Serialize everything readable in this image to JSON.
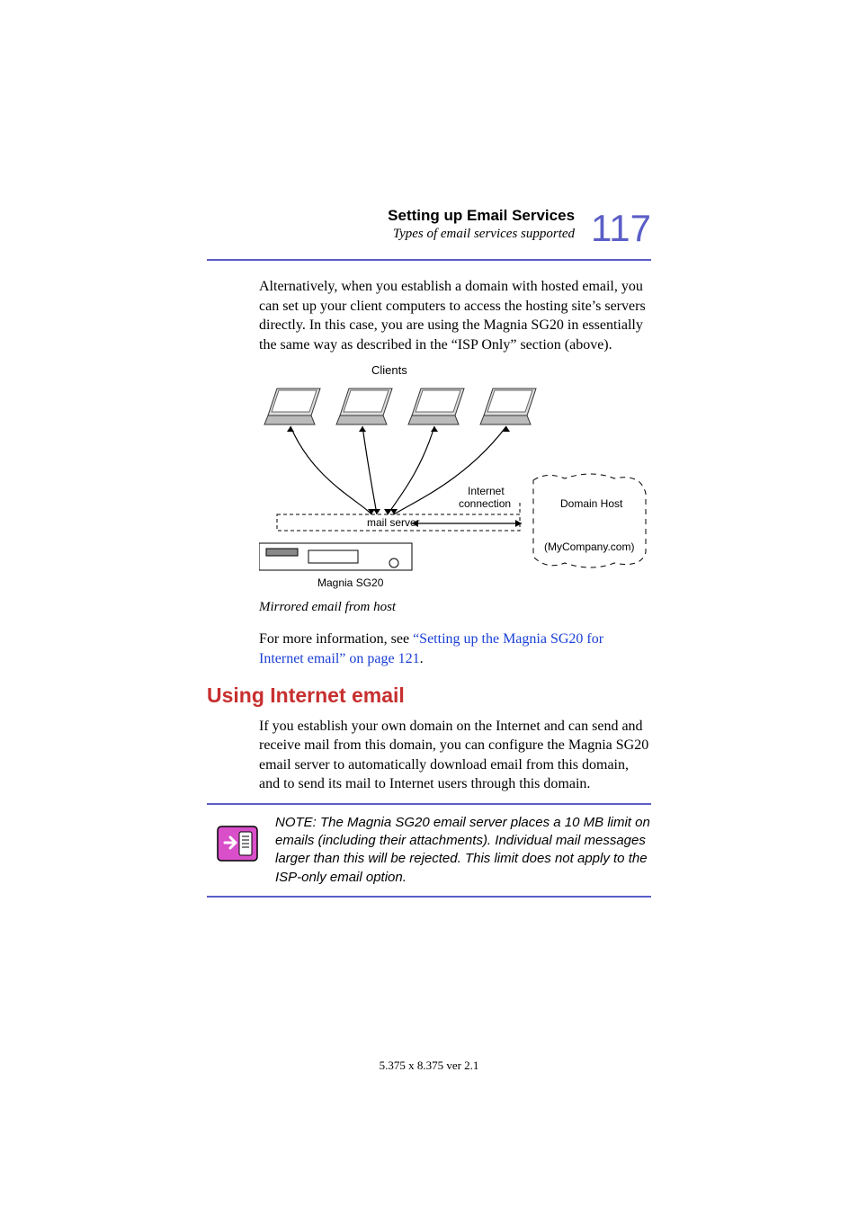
{
  "header": {
    "title": "Setting up Email Services",
    "subtitle": "Types of email services supported",
    "page_number": "117"
  },
  "paragraphs": {
    "p1": "Alternatively, when you establish a domain with hosted email, you can set up your client computers to access the hosting site’s servers directly. In this case, you are using the Magnia SG20 in essentially the same way as described in the “ISP Only” section (above).",
    "p2_pre": "For more information, see ",
    "p2_link": "“Setting up the Magnia SG20 for Internet email” on page 121",
    "p2_post": ".",
    "p3": "If you establish your own domain on the Internet and can send and receive mail from this domain, you can configure the Magnia SG20 email server to automatically download email from this domain, and to send its mail to Internet users through this domain."
  },
  "figure": {
    "labels": {
      "clients": "Clients",
      "internet": "Internet connection",
      "domain_host": "Domain Host",
      "my_company": "(MyCompany.com)",
      "mail_server": "mail server",
      "magnia": "Magnia SG20"
    },
    "caption": "Mirrored email from host"
  },
  "section": {
    "heading": "Using Internet email"
  },
  "note": {
    "text": "NOTE: The Magnia SG20 email server places a 10 MB limit on emails (including their attachments). Individual mail messages larger than this will be rejected. This limit does not apply to the ISP-only email option."
  },
  "footer": {
    "text": "5.375 x 8.375 ver 2.1"
  }
}
